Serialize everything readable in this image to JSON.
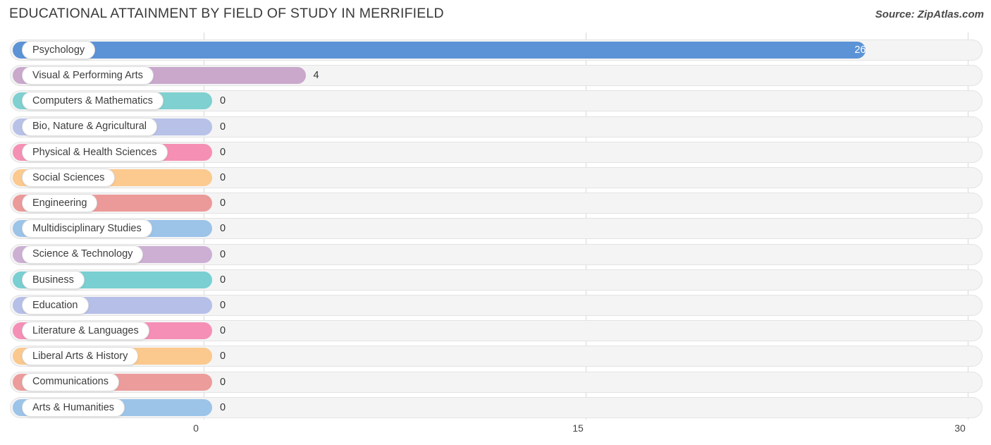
{
  "header": {
    "title": "EDUCATIONAL ATTAINMENT BY FIELD OF STUDY IN MERRIFIELD",
    "source": "Source: ZipAtlas.com"
  },
  "chart_data": {
    "type": "bar",
    "orientation": "horizontal",
    "title": "EDUCATIONAL ATTAINMENT BY FIELD OF STUDY IN MERRIFIELD",
    "xlabel": "",
    "ylabel": "",
    "xlim": [
      0,
      30
    ],
    "grid": true,
    "legend": "none",
    "xticks": [
      "0",
      "15",
      "30"
    ],
    "xtick_values": [
      0,
      15,
      30
    ],
    "categories": [
      "Psychology",
      "Visual & Performing Arts",
      "Computers & Mathematics",
      "Bio, Nature & Agricultural",
      "Physical & Health Sciences",
      "Social Sciences",
      "Engineering",
      "Multidisciplinary Studies",
      "Science & Technology",
      "Business",
      "Education",
      "Literature & Languages",
      "Liberal Arts & History",
      "Communications",
      "Arts & Humanities"
    ],
    "values": [
      26,
      4,
      0,
      0,
      0,
      0,
      0,
      0,
      0,
      0,
      0,
      0,
      0,
      0,
      0
    ],
    "value_labels": [
      "26",
      "4",
      "0",
      "0",
      "0",
      "0",
      "0",
      "0",
      "0",
      "0",
      "0",
      "0",
      "0",
      "0",
      "0"
    ],
    "colors": [
      "#5b93d6",
      "#c9a8cc",
      "#7fd0d0",
      "#b8c1e8",
      "#f590b4",
      "#fcc98e",
      "#eb9a99",
      "#9cc3e8",
      "#cdafd4",
      "#79cfd1",
      "#b6bfe8",
      "#f58fb6",
      "#fbc88d",
      "#eb9c9b",
      "#9cc4e9"
    ]
  }
}
